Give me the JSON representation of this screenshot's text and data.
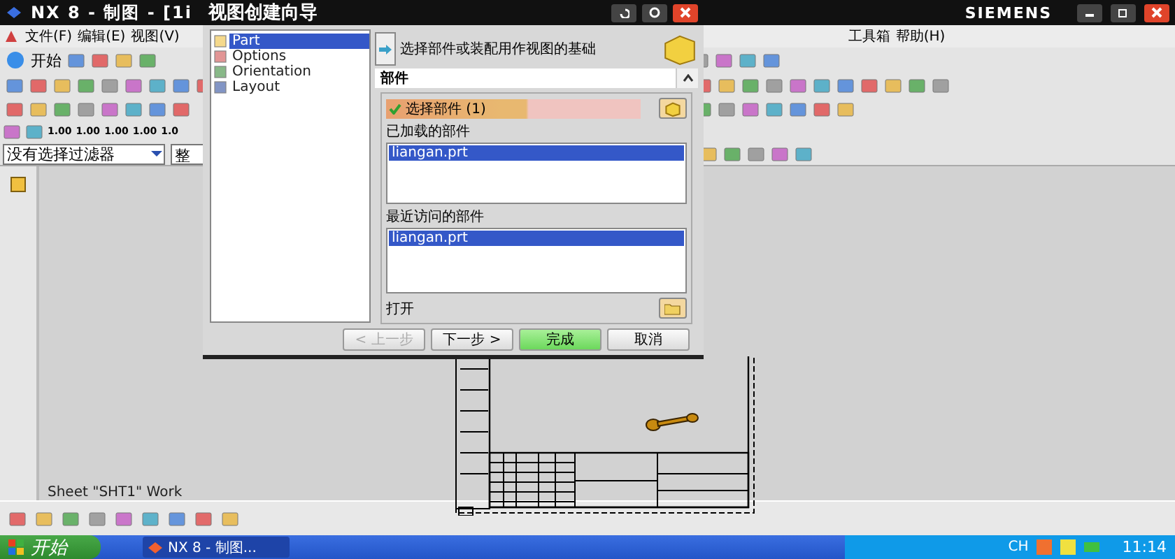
{
  "app_window": {
    "title": "NX 8 - 制图 - [1i",
    "brand": "SIEMENS"
  },
  "menu_left": [
    "文件(F)",
    "编辑(E)",
    "视图(V)"
  ],
  "menu_right": [
    "工具箱",
    "帮助(H)"
  ],
  "start_tool": "开始",
  "dimension_tools": [
    "1.00",
    "1.00",
    "1.00",
    "1.00",
    "1.0"
  ],
  "filter": {
    "value": "没有选择过滤器",
    "scope": "整"
  },
  "status": "Sheet \"SHT1\" Work",
  "dialog": {
    "title": "视图创建向导",
    "steps": [
      {
        "label": "Part",
        "selected": true
      },
      {
        "label": "Options",
        "selected": false
      },
      {
        "label": "Orientation",
        "selected": false
      },
      {
        "label": "Layout",
        "selected": false
      }
    ],
    "hint": "选择部件或装配用作视图的基础",
    "section": {
      "title": "部件",
      "expanded": true
    },
    "select": {
      "label": "选择部件 (1)",
      "done": true
    },
    "loaded": {
      "label": "已加载的部件",
      "items": [
        {
          "name": "liangan.prt",
          "selected": true
        }
      ]
    },
    "recent": {
      "label": "最近访问的部件",
      "items": [
        {
          "name": "liangan.prt",
          "selected": true
        }
      ]
    },
    "open_label": "打开",
    "buttons": [
      {
        "label": "< 上一步",
        "kind": "normal",
        "disabled": true
      },
      {
        "label": "下一步 >",
        "kind": "normal",
        "disabled": false
      },
      {
        "label": "完成",
        "kind": "primary",
        "disabled": false
      },
      {
        "label": "取消",
        "kind": "normal",
        "disabled": false
      }
    ]
  },
  "taskbar": {
    "start": "开始",
    "tasks": [
      {
        "label": "NX 8 - 制图...",
        "selected": true
      }
    ],
    "lang": "CH",
    "time": "11:14"
  }
}
